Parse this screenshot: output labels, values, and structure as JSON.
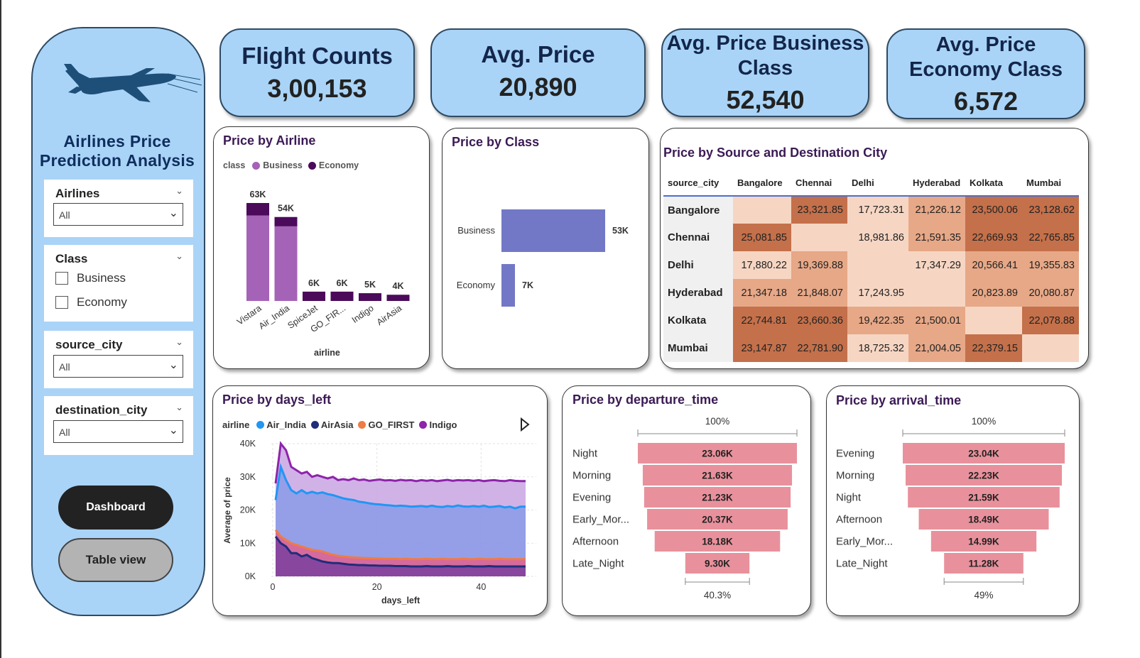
{
  "sidebar": {
    "app_title_line1": "Airlines Price",
    "app_title_line2": "Prediction Analysis",
    "slicers": {
      "airlines": {
        "label": "Airlines",
        "value": "All"
      },
      "class": {
        "label": "Class",
        "options": [
          "Business",
          "Economy"
        ]
      },
      "source_city": {
        "label": "source_city",
        "value": "All"
      },
      "destination_city": {
        "label": "destination_city",
        "value": "All"
      }
    },
    "buttons": {
      "dashboard": "Dashboard",
      "table_view": "Table view"
    }
  },
  "kpis": {
    "flight_counts": {
      "label": "Flight Counts",
      "value": "3,00,153"
    },
    "avg_price": {
      "label": "Avg. Price",
      "value": "20,890"
    },
    "avg_business": {
      "label_line1": "Avg. Price Business",
      "label_line2": "Class",
      "value": "52,540"
    },
    "avg_economy": {
      "label_line1": "Avg. Price",
      "label_line2": "Economy Class",
      "value": "6,572"
    }
  },
  "colors": {
    "kpi_bg": "#a9d4f7",
    "business": "#a563b7",
    "economy": "#4b0a5a",
    "class_bar": "#7278c6",
    "funnel": "#e8919c",
    "heat_high": "#c4704a",
    "heat_mid": "#e7a887",
    "heat_low": "#f6d6c3"
  },
  "price_by_airline": {
    "title": "Price by Airline",
    "legend_label": "class",
    "x_axis_title": "airline"
  },
  "price_by_class": {
    "title": "Price by Class"
  },
  "price_by_city": {
    "title": "Price by Source and Destination City",
    "corner_header": "source_city",
    "columns": [
      "Bangalore",
      "Chennai",
      "Delhi",
      "Hyderabad",
      "Kolkata",
      "Mumbai"
    ],
    "rows": [
      {
        "city": "Bangalore",
        "values": [
          "",
          "23,321.85",
          "17,723.31",
          "21,226.12",
          "23,500.06",
          "23,128.62"
        ]
      },
      {
        "city": "Chennai",
        "values": [
          "25,081.85",
          "",
          "18,981.86",
          "21,591.35",
          "22,669.93",
          "22,765.85"
        ]
      },
      {
        "city": "Delhi",
        "values": [
          "17,880.22",
          "19,369.88",
          "",
          "17,347.29",
          "20,566.41",
          "19,355.83"
        ]
      },
      {
        "city": "Hyderabad",
        "values": [
          "21,347.18",
          "21,848.07",
          "17,243.95",
          "",
          "20,823.89",
          "20,080.87"
        ]
      },
      {
        "city": "Kolkata",
        "values": [
          "22,744.81",
          "23,660.36",
          "19,422.35",
          "21,500.01",
          "",
          "22,078.88"
        ]
      },
      {
        "city": "Mumbai",
        "values": [
          "23,147.87",
          "22,781.90",
          "18,725.32",
          "21,004.05",
          "22,379.15",
          ""
        ]
      }
    ]
  },
  "price_by_days_left": {
    "title": "Price by days_left",
    "legend_label": "airline",
    "x_axis_title": "days_left",
    "y_axis_title": "Average of price"
  },
  "price_by_departure": {
    "title": "Price by departure_time"
  },
  "price_by_arrival": {
    "title": "Price by arrival_time"
  },
  "chart_data": [
    {
      "id": "airline",
      "type": "bar",
      "stacked": true,
      "categories": [
        "Vistara",
        "Air_India",
        "SpiceJet",
        "GO_FIR...",
        "Indigo",
        "AirAsia"
      ],
      "series": [
        {
          "name": "Business",
          "values": [
            55000,
            48000,
            0,
            0,
            0,
            0
          ]
        },
        {
          "name": "Economy",
          "values": [
            8000,
            6000,
            6000,
            6000,
            5000,
            4000
          ]
        }
      ],
      "total_labels": [
        "63K",
        "54K",
        "6K",
        "6K",
        "5K",
        "4K"
      ],
      "ylim": [
        0,
        63000
      ]
    },
    {
      "id": "class",
      "type": "bar",
      "orientation": "horizontal",
      "categories": [
        "Business",
        "Economy"
      ],
      "values": [
        52540,
        6572
      ],
      "labels": [
        "53K",
        "7K"
      ]
    },
    {
      "id": "days_left",
      "type": "area",
      "x_ticks": [
        0,
        20,
        40
      ],
      "y_ticks": [
        "0K",
        "10K",
        "20K",
        "30K",
        "40K"
      ],
      "ylim": [
        0,
        40000
      ],
      "xlim": [
        1,
        49
      ],
      "series": [
        {
          "name": "Air_India",
          "color": "#2196f3",
          "values": [
            23000,
            33000,
            29000,
            26000,
            25000,
            26000,
            25000,
            25500,
            25000,
            25300,
            24800,
            24500,
            24000,
            23500,
            23200,
            23000,
            22500,
            22300,
            22000,
            21800,
            21700,
            21500,
            21400,
            21200,
            21300,
            21200,
            21000,
            21100,
            21200,
            21000,
            21300,
            21000,
            20900,
            21200,
            21000,
            21400,
            21100,
            21000,
            21200,
            21000,
            21300,
            20900,
            21000,
            21200,
            20800,
            21000,
            20500,
            21000,
            21000
          ]
        },
        {
          "name": "AirAsia",
          "color": "#1f2d7a",
          "values": [
            12000,
            10000,
            9000,
            7000,
            7000,
            6000,
            6500,
            5500,
            5000,
            4500,
            4200,
            4000,
            4000,
            3800,
            3600,
            3500,
            3400,
            3400,
            3300,
            3300,
            3200,
            3200,
            3200,
            3100,
            3100,
            3100,
            3000,
            3000,
            3000,
            3100,
            3000,
            3000,
            3000,
            3100,
            3000,
            3000,
            3000,
            3100,
            3000,
            3000,
            3000,
            3100,
            3000,
            3000,
            3000,
            3000,
            3000,
            3000,
            3000
          ]
        },
        {
          "name": "GO_FIRST",
          "color": "#ef7b45",
          "values": [
            14000,
            12000,
            11000,
            10000,
            9500,
            9000,
            8500,
            8000,
            7800,
            7500,
            7000,
            6500,
            6200,
            6000,
            5800,
            5700,
            5600,
            5500,
            5500,
            5400,
            5400,
            5300,
            5300,
            5300,
            5200,
            5300,
            5200,
            5200,
            5200,
            5300,
            5200,
            5200,
            5300,
            5200,
            5200,
            5200,
            5300,
            5200,
            5200,
            5300,
            5200,
            5200,
            5200,
            5300,
            5200,
            5200,
            5200,
            5200,
            5200
          ]
        },
        {
          "name": "Indigo",
          "color": "#8e24aa",
          "values": [
            28000,
            40000,
            38000,
            33000,
            32000,
            31000,
            31500,
            30000,
            30500,
            30000,
            29500,
            30000,
            29000,
            29300,
            29000,
            29500,
            29000,
            29200,
            28800,
            29000,
            29200,
            28900,
            29000,
            28800,
            29100,
            28900,
            29000,
            28700,
            29000,
            28800,
            29000,
            28700,
            28900,
            29100,
            28800,
            29000,
            28900,
            29000,
            28800,
            29000,
            28700,
            28900,
            29000,
            28800,
            28700,
            29000,
            28800,
            28700,
            28700
          ]
        }
      ]
    },
    {
      "id": "departure",
      "type": "bar",
      "orientation": "funnel",
      "categories": [
        "Night",
        "Morning",
        "Evening",
        "Early_Mor...",
        "Afternoon",
        "Late_Night"
      ],
      "values": [
        23.06,
        21.63,
        21.23,
        20.37,
        18.18,
        9.3
      ],
      "labels": [
        "23.06K",
        "21.63K",
        "21.23K",
        "20.37K",
        "18.18K",
        "9.30K"
      ],
      "top_label": "100%",
      "bottom_label": "40.3%"
    },
    {
      "id": "arrival",
      "type": "bar",
      "orientation": "funnel",
      "categories": [
        "Evening",
        "Morning",
        "Night",
        "Afternoon",
        "Early_Mor...",
        "Late_Night"
      ],
      "values": [
        23.04,
        22.23,
        21.59,
        18.49,
        14.99,
        11.28
      ],
      "labels": [
        "23.04K",
        "22.23K",
        "21.59K",
        "18.49K",
        "14.99K",
        "11.28K"
      ],
      "top_label": "100%",
      "bottom_label": "49%"
    }
  ]
}
